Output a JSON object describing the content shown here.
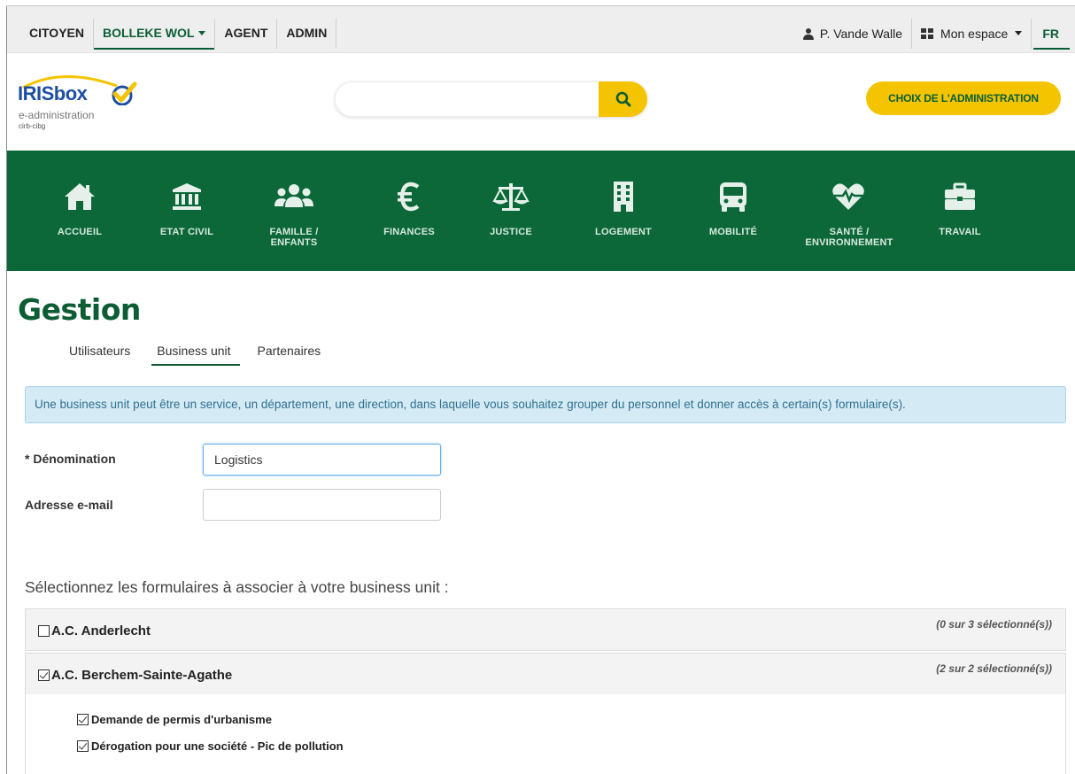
{
  "topbar": {
    "left_items": [
      "CITOYEN",
      "BOLLEKE WOL",
      "AGENT",
      "ADMIN"
    ],
    "user_name": "P. Vande Walle",
    "mon_espace": "Mon espace",
    "lang": "FR"
  },
  "header": {
    "logo_text": "IRISbox",
    "logo_sub1": "e-administration",
    "logo_sub2": "cirb-cibg",
    "search_placeholder": "",
    "choix_button": "CHOIX DE L'ADMINISTRATION"
  },
  "nav": [
    {
      "label": "ACCUEIL",
      "icon": "home-icon"
    },
    {
      "label": "ETAT CIVIL",
      "icon": "institution-icon"
    },
    {
      "label": "FAMILLE / ENFANTS",
      "icon": "users-icon"
    },
    {
      "label": "FINANCES",
      "icon": "euro-icon"
    },
    {
      "label": "JUSTICE",
      "icon": "balance-icon"
    },
    {
      "label": "LOGEMENT",
      "icon": "building-icon"
    },
    {
      "label": "MOBILITÉ",
      "icon": "bus-icon"
    },
    {
      "label": "SANTÉ / ENVIRONNEMENT",
      "icon": "heartbeat-icon"
    },
    {
      "label": "TRAVAIL",
      "icon": "briefcase-icon"
    }
  ],
  "page": {
    "title": "Gestion",
    "tabs": [
      "Utilisateurs",
      "Business unit",
      "Partenaires"
    ],
    "active_tab": "Business unit",
    "info": "Une business unit peut être un service, un département, une direction, dans laquelle vous souhaitez grouper du personnel et donner accès à certain(s) formulaire(s)."
  },
  "form": {
    "denomination_label": "* Dénomination",
    "denomination_value": "Logistics",
    "email_label": "Adresse e-mail",
    "email_value": ""
  },
  "forms_section": {
    "title": "Sélectionnez les formulaires à associer à votre business unit :",
    "panels": [
      {
        "title": "A.C. Anderlecht",
        "count": "(0 sur 3 sélectionné(s))",
        "checked": false
      },
      {
        "title": "A.C. Berchem-Sainte-Agathe",
        "count": "(2 sur 2 sélectionné(s))",
        "checked": true,
        "items": [
          "Demande de permis d'urbanisme",
          "Dérogation pour une société - Pic de pollution"
        ]
      }
    ]
  },
  "colors": {
    "green": "#0c6838",
    "yellow": "#f4c400",
    "logo_blue": "#1d4fa3",
    "info_bg": "#d4ebf6"
  }
}
